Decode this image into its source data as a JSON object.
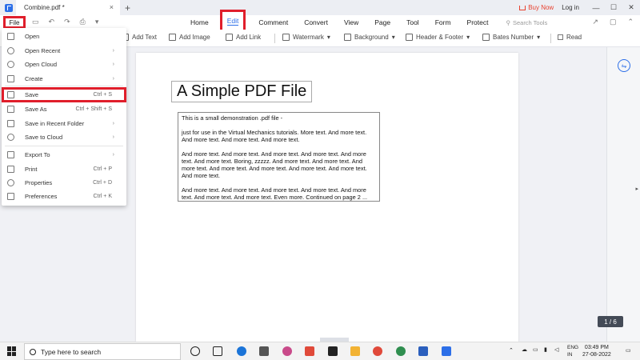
{
  "titlebar": {
    "tab_title": "Combine.pdf *",
    "tab_close": "×",
    "new_tab": "+",
    "buy_now": "Buy Now",
    "login": "Log in",
    "minimize": "—",
    "maximize": "☐",
    "close": "✕"
  },
  "menubar": {
    "file": "File",
    "items": [
      "Home",
      "Edit",
      "Comment",
      "Convert",
      "View",
      "Page",
      "Tool",
      "Form",
      "Protect"
    ],
    "search_placeholder": "Search Tools"
  },
  "ribbon": {
    "add_text": "Add Text",
    "add_image": "Add Image",
    "add_link": "Add Link",
    "watermark": "Watermark",
    "background": "Background",
    "header_footer": "Header & Footer",
    "bates_number": "Bates Number",
    "read": "Read"
  },
  "file_menu": {
    "items": [
      {
        "label": "Open",
        "shortcut": "",
        "arrow": ""
      },
      {
        "label": "Open Recent",
        "shortcut": "",
        "arrow": "›"
      },
      {
        "label": "Open Cloud",
        "shortcut": "",
        "arrow": "›"
      },
      {
        "label": "Create",
        "shortcut": "",
        "arrow": "›"
      },
      {
        "label": "Save",
        "shortcut": "Ctrl + S",
        "arrow": ""
      },
      {
        "label": "Save As",
        "shortcut": "Ctrl + Shift + S",
        "arrow": ""
      },
      {
        "label": "Save in Recent Folder",
        "shortcut": "",
        "arrow": "›"
      },
      {
        "label": "Save to Cloud",
        "shortcut": "",
        "arrow": "›"
      },
      {
        "label": "Export To",
        "shortcut": "",
        "arrow": "›"
      },
      {
        "label": "Print",
        "shortcut": "Ctrl + P",
        "arrow": ""
      },
      {
        "label": "Properties",
        "shortcut": "Ctrl + D",
        "arrow": ""
      },
      {
        "label": "Preferences",
        "shortcut": "Ctrl + K",
        "arrow": ""
      }
    ]
  },
  "document": {
    "title": "A Simple PDF File",
    "paragraphs": [
      "This is a small demonstration .pdf file -",
      "just for use in the Virtual Mechanics tutorials. More text. And more text. And more text. And more text. And more text.",
      "And more text. And more text. And more text. And more text. And more text. And more text. Boring, zzzzz. And more text. And more text. And more text. And more text. And more text. And more text. And more text. And more text.",
      "And more text. And more text. And more text. And more text. And more text. And more text. And more text. Even more. Continued on page 2 ..."
    ],
    "page_counter": "1 / 6"
  },
  "taskbar": {
    "search_placeholder": "Type here to search",
    "lang_line1": "ENG",
    "lang_line2": "IN",
    "time": "03:49 PM",
    "date": "27-08-2022"
  },
  "colors": {
    "highlight": "#e01e2b",
    "accent": "#2d6fe8"
  }
}
